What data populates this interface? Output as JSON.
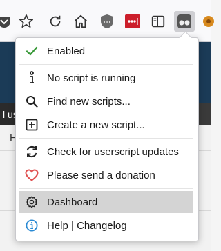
{
  "menu": {
    "enabled": "Enabled",
    "no_script": "No script is running",
    "find_scripts": "Find new scripts...",
    "create_script": "Create a new script...",
    "check_updates": "Check for userscript updates",
    "donate": "Please send a donation",
    "dashboard": "Dashboard",
    "help": "Help | Changelog"
  },
  "page": {
    "band_text": "l us",
    "letter": "H"
  },
  "colors": {
    "enabled_check": "#3a9a3a",
    "donate_heart": "#e05050",
    "help_icon": "#2a8ad4",
    "active_item_bg": "#d4d4d4",
    "page_header": "#1b3b57"
  },
  "icons": {
    "toolbar": [
      "pocket-icon",
      "bookmark-star-icon",
      "reload-icon",
      "home-icon",
      "ublock-icon",
      "lastpass-icon",
      "reader-view-icon",
      "tampermonkey-icon",
      "extension-icon"
    ],
    "menu": [
      "check-icon",
      "info-icon",
      "search-icon",
      "plus-box-icon",
      "refresh-icon",
      "heart-icon",
      "gear-icon",
      "info-circle-icon"
    ]
  }
}
